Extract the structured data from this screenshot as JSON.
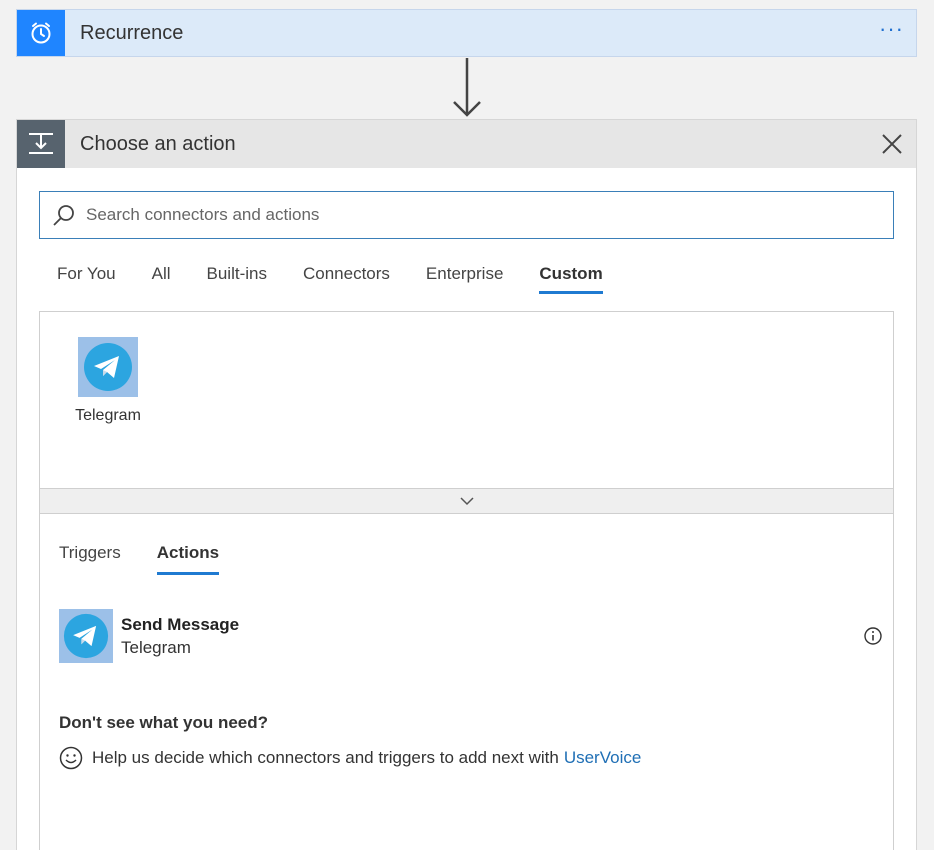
{
  "recurrence": {
    "title": "Recurrence",
    "icon": "alarm-clock-icon",
    "more_label": "···",
    "accent_color": "#1f85ff"
  },
  "action_panel": {
    "title": "Choose an action",
    "icon": "action-step-icon",
    "search": {
      "placeholder": "Search connectors and actions",
      "value": ""
    },
    "category_tabs": [
      {
        "label": "For You",
        "active": false
      },
      {
        "label": "All",
        "active": false
      },
      {
        "label": "Built-ins",
        "active": false
      },
      {
        "label": "Connectors",
        "active": false
      },
      {
        "label": "Enterprise",
        "active": false
      },
      {
        "label": "Custom",
        "active": true
      }
    ],
    "connectors": [
      {
        "label": "Telegram",
        "icon": "telegram-icon"
      }
    ],
    "sub_tabs": [
      {
        "label": "Triggers",
        "active": false
      },
      {
        "label": "Actions",
        "active": true
      }
    ],
    "actions": [
      {
        "name": "Send Message",
        "connector": "Telegram",
        "icon": "telegram-icon"
      }
    ],
    "help": {
      "heading": "Don't see what you need?",
      "text": "Help us decide which connectors and triggers to add next with",
      "link": "UserVoice"
    }
  },
  "colors": {
    "tab_underline": "#1f7ad1",
    "link": "#1f6fb5",
    "telegram_blue": "#2ca5e0"
  }
}
